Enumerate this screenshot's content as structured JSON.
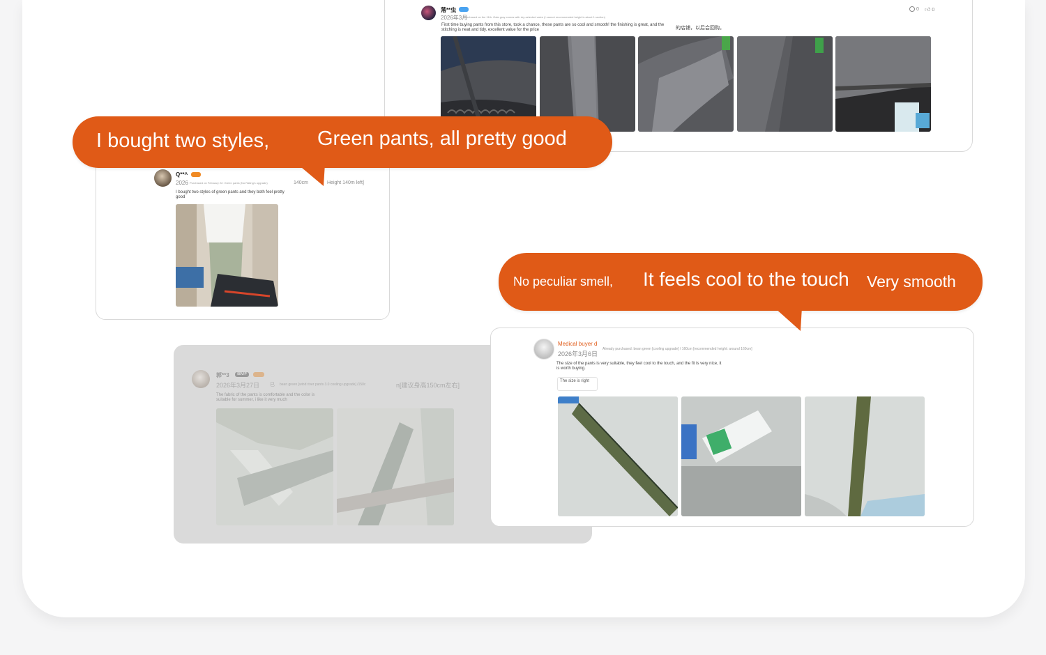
{
  "colors": {
    "accent": "#e05a17",
    "card_border": "#d9d9d9",
    "faded_card": "#dadada"
  },
  "review1": {
    "user": "落**虫",
    "date": "2026年3月",
    "purchase": "Purchased on the 11th. Gala gray comes with dry-selected valve (I cannot recommended height is about 1 section)",
    "text": "First time buying pants from this store, took a chance, these pants are so cool and smooth! the finishing is great, and the stitching is neat and tidy. excellent value for the price",
    "text_cn": "的店铺，以后会回购。",
    "comment_count": "0",
    "like_count": "0",
    "comment_icon": "comment-icon",
    "like_icon": "thumbs-up-icon"
  },
  "review2": {
    "user": "Q**^",
    "date": "2026",
    "purchase": "Purchased on February 22: Green pants (No Rating's upgrade)",
    "height": "140cm",
    "height_note": "Height 140m left]",
    "text": "I bought two styles of green pants and they both feel pretty good"
  },
  "review3": {
    "user": "郭**3",
    "vip": "88VIP",
    "date": "2026年3月27日",
    "purchase": "已",
    "variant": "bean green [wind river pants 3.0 cooling upgrade] /150c",
    "height_note": "n[建议身高150cm左右]",
    "text": "The fabric of the pants is comfortable and the color is suitable for summer, i like it very much"
  },
  "review4": {
    "user": "Medical buyer d",
    "date": "2026年3月6日",
    "purchase": "Already purchased: bean green [cooling upgrade] / 160cm [recommended height: around 160cm]",
    "text": "The size of the pants is very suitable, they feel cool to the touch, and the fit is very nice, it is worth buying.",
    "tag": "The size is right"
  },
  "bubble1": {
    "part1": "I bought two styles,",
    "part2": "Green pants, all pretty good"
  },
  "bubble2": {
    "part1": "No peculiar smell,",
    "part2": "It feels cool to the touch",
    "part3": "Very smooth"
  }
}
